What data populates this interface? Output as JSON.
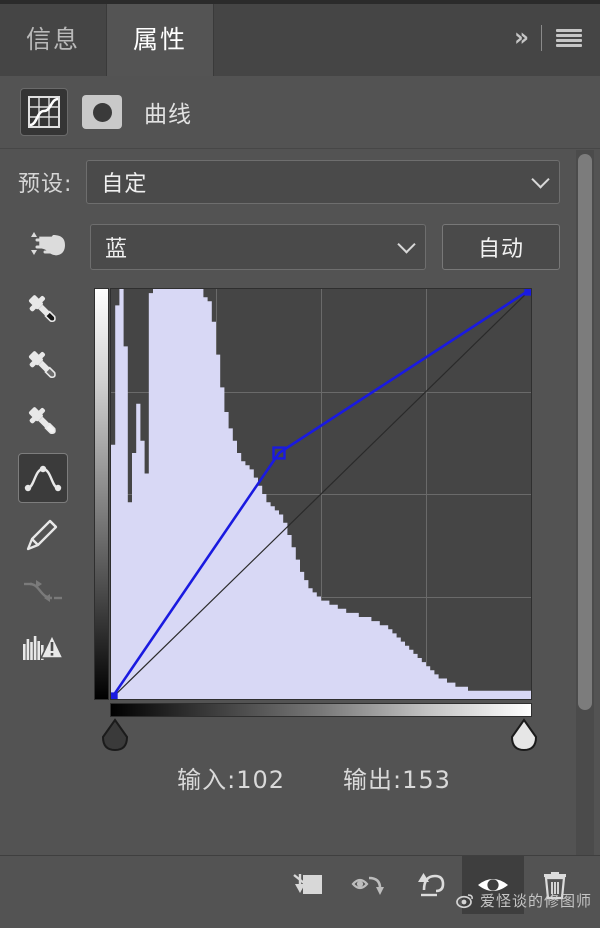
{
  "panel": {
    "tabs": [
      {
        "label": "信息",
        "name": "tab-info",
        "active": false
      },
      {
        "label": "属性",
        "name": "tab-properties",
        "active": true
      }
    ],
    "collapse_icon": "double-chevron-right-icon",
    "menu_icon": "panel-menu-icon",
    "collapse_glyph": "»"
  },
  "adjustment": {
    "title": "曲线",
    "layer_icon": "curves-adjustment-icon",
    "mask_icon": "layer-mask-thumbnail-icon"
  },
  "preset": {
    "label": "预设:",
    "value": "自定",
    "placeholder": "自定"
  },
  "channel": {
    "icon": "channel-presets-icon",
    "value": "蓝",
    "auto_label": "自动"
  },
  "tools": [
    {
      "name": "tool-sample-black-point",
      "icon": "eyedropper-black-icon",
      "label": "在图像中取样以设置黑场",
      "state": "normal"
    },
    {
      "name": "tool-sample-gray-point",
      "icon": "eyedropper-gray-icon",
      "label": "在图像中取样以设置灰场",
      "state": "normal"
    },
    {
      "name": "tool-sample-white-point",
      "icon": "eyedropper-white-icon",
      "label": "在图像中取样以设置白场",
      "state": "normal"
    },
    {
      "name": "tool-edit-points",
      "icon": "curve-points-icon",
      "label": "编辑点以修改曲线",
      "state": "selected"
    },
    {
      "name": "tool-draw-curve",
      "icon": "pencil-icon",
      "label": "通过绘制来修改曲线",
      "state": "normal"
    },
    {
      "name": "tool-smooth-curve",
      "icon": "smooth-curve-icon",
      "label": "平滑曲线值",
      "state": "disabled"
    },
    {
      "name": "tool-clipping-warning",
      "icon": "histogram-warning-icon",
      "label": "显示修剪",
      "state": "normal"
    }
  ],
  "readout": {
    "input_label": "输入:",
    "input_value": "102",
    "output_label": "输出:",
    "output_value": "153"
  },
  "bottom_tools": [
    {
      "name": "clip-to-layer-button",
      "icon": "clip-to-layer-icon",
      "active": false
    },
    {
      "name": "toggle-layer-visibility-previous-button",
      "icon": "eye-arrow-icon",
      "active": false
    },
    {
      "name": "reset-adjustment-button",
      "icon": "reset-arrow-icon",
      "active": false
    },
    {
      "name": "toggle-layer-visibility-button",
      "icon": "eye-icon",
      "active": true
    },
    {
      "name": "delete-adjustment-layer-button",
      "icon": "trash-icon",
      "active": false
    }
  ],
  "watermark": {
    "text": "爱怪谈的修图师",
    "icon": "weibo-logo-icon"
  },
  "colors": {
    "panel_bg": "#535353",
    "tabbar_bg": "#454545",
    "graph_bg": "#454545",
    "grid_line": "#6a6a6a",
    "curve": "#1a1ae0",
    "histogram": "#d8d8f5",
    "text": "#d9d9d9",
    "scrollbar_thumb": "#7c7c7c"
  },
  "chart_data": {
    "type": "line",
    "title": "曲线 (Curves) — 蓝 channel",
    "xlabel": "输入 (Input)",
    "ylabel": "输出 (Output)",
    "xlim": [
      0,
      255
    ],
    "ylim": [
      0,
      255
    ],
    "grid": true,
    "grid_divisions": 4,
    "series": [
      {
        "name": "baseline-diagonal",
        "type": "reference",
        "points": [
          [
            0,
            0
          ],
          [
            255,
            255
          ]
        ]
      },
      {
        "name": "blue-channel-curve",
        "type": "curve",
        "color": "#1a1ae0",
        "points": [
          [
            0,
            0
          ],
          [
            102,
            153
          ],
          [
            255,
            255
          ]
        ],
        "control_points": [
          {
            "input": 0,
            "output": 0,
            "selected": true
          },
          {
            "input": 102,
            "output": 153,
            "selected": false
          },
          {
            "input": 255,
            "output": 255,
            "selected": false
          }
        ]
      }
    ],
    "histogram": {
      "name": "blue-channel-histogram",
      "color": "#d8d8f5",
      "bins": [
        0.62,
        0.96,
        1.0,
        0.86,
        0.48,
        0.6,
        0.72,
        0.63,
        0.55,
        0.99,
        1.0,
        1.0,
        1.0,
        1.0,
        1.0,
        1.0,
        1.0,
        1.0,
        1.0,
        1.0,
        1.0,
        1.0,
        0.98,
        0.97,
        0.92,
        0.84,
        0.76,
        0.7,
        0.66,
        0.63,
        0.6,
        0.58,
        0.57,
        0.56,
        0.54,
        0.52,
        0.5,
        0.48,
        0.47,
        0.46,
        0.45,
        0.43,
        0.4,
        0.37,
        0.34,
        0.31,
        0.29,
        0.27,
        0.26,
        0.25,
        0.24,
        0.24,
        0.23,
        0.23,
        0.22,
        0.22,
        0.21,
        0.21,
        0.21,
        0.2,
        0.2,
        0.2,
        0.19,
        0.19,
        0.18,
        0.18,
        0.17,
        0.16,
        0.15,
        0.14,
        0.13,
        0.12,
        0.11,
        0.1,
        0.09,
        0.08,
        0.07,
        0.06,
        0.05,
        0.05,
        0.04,
        0.04,
        0.03,
        0.03,
        0.03,
        0.02,
        0.02,
        0.02,
        0.02,
        0.02,
        0.02,
        0.02,
        0.02,
        0.02,
        0.02,
        0.02,
        0.02,
        0.02,
        0.02,
        0.02
      ]
    },
    "gradient_ramps": {
      "vertical": [
        "#ffffff",
        "#000000"
      ],
      "horizontal": [
        "#000000",
        "#ffffff"
      ]
    },
    "black_point_marker": 0,
    "white_point_marker": 255
  }
}
